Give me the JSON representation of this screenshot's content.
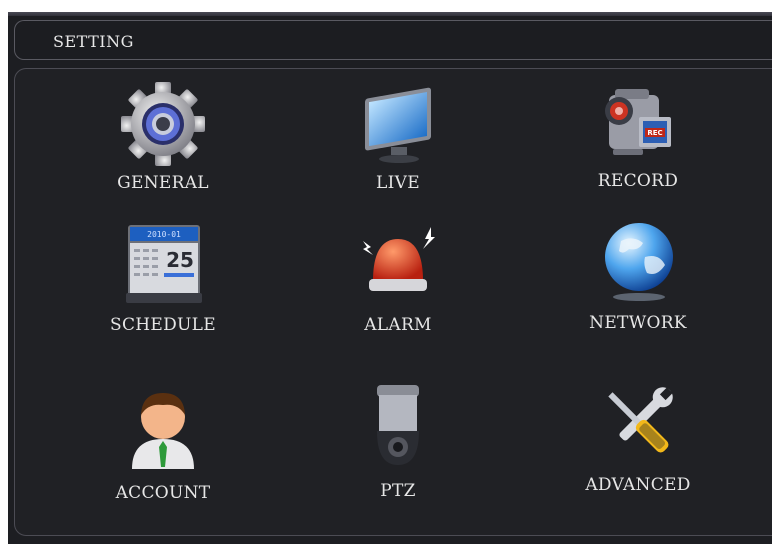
{
  "window": {
    "title": "SETTING"
  },
  "menu": {
    "items": [
      {
        "label": "GENERAL",
        "icon": "gear-icon"
      },
      {
        "label": "LIVE",
        "icon": "monitor-icon"
      },
      {
        "label": "RECORD",
        "icon": "camcorder-icon",
        "badge": "REC"
      },
      {
        "label": "SCHEDULE",
        "icon": "calendar-icon",
        "calendar_header": "2010-01",
        "calendar_day": "25"
      },
      {
        "label": "ALARM",
        "icon": "siren-icon"
      },
      {
        "label": "NETWORK",
        "icon": "globe-icon"
      },
      {
        "label": "ACCOUNT",
        "icon": "user-icon"
      },
      {
        "label": "PTZ",
        "icon": "dome-camera-icon"
      },
      {
        "label": "ADVANCED",
        "icon": "tools-icon"
      }
    ]
  },
  "colors": {
    "background": "#202125",
    "text": "#e6e6e6",
    "alarm_red": "#d4301a",
    "accent_blue": "#3a6fd8"
  }
}
